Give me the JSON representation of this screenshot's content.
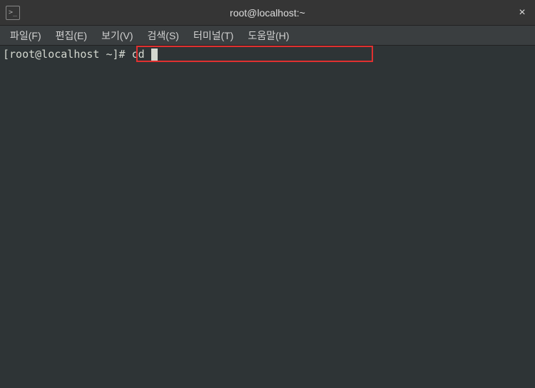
{
  "titlebar": {
    "icon_glyph": ">_",
    "title": "root@localhost:~",
    "close": "×"
  },
  "menubar": {
    "items": [
      "파일(F)",
      "편집(E)",
      "보기(V)",
      "검색(S)",
      "터미널(T)",
      "도움말(H)"
    ]
  },
  "terminal": {
    "prompt": "[root@localhost ~]# cd "
  }
}
